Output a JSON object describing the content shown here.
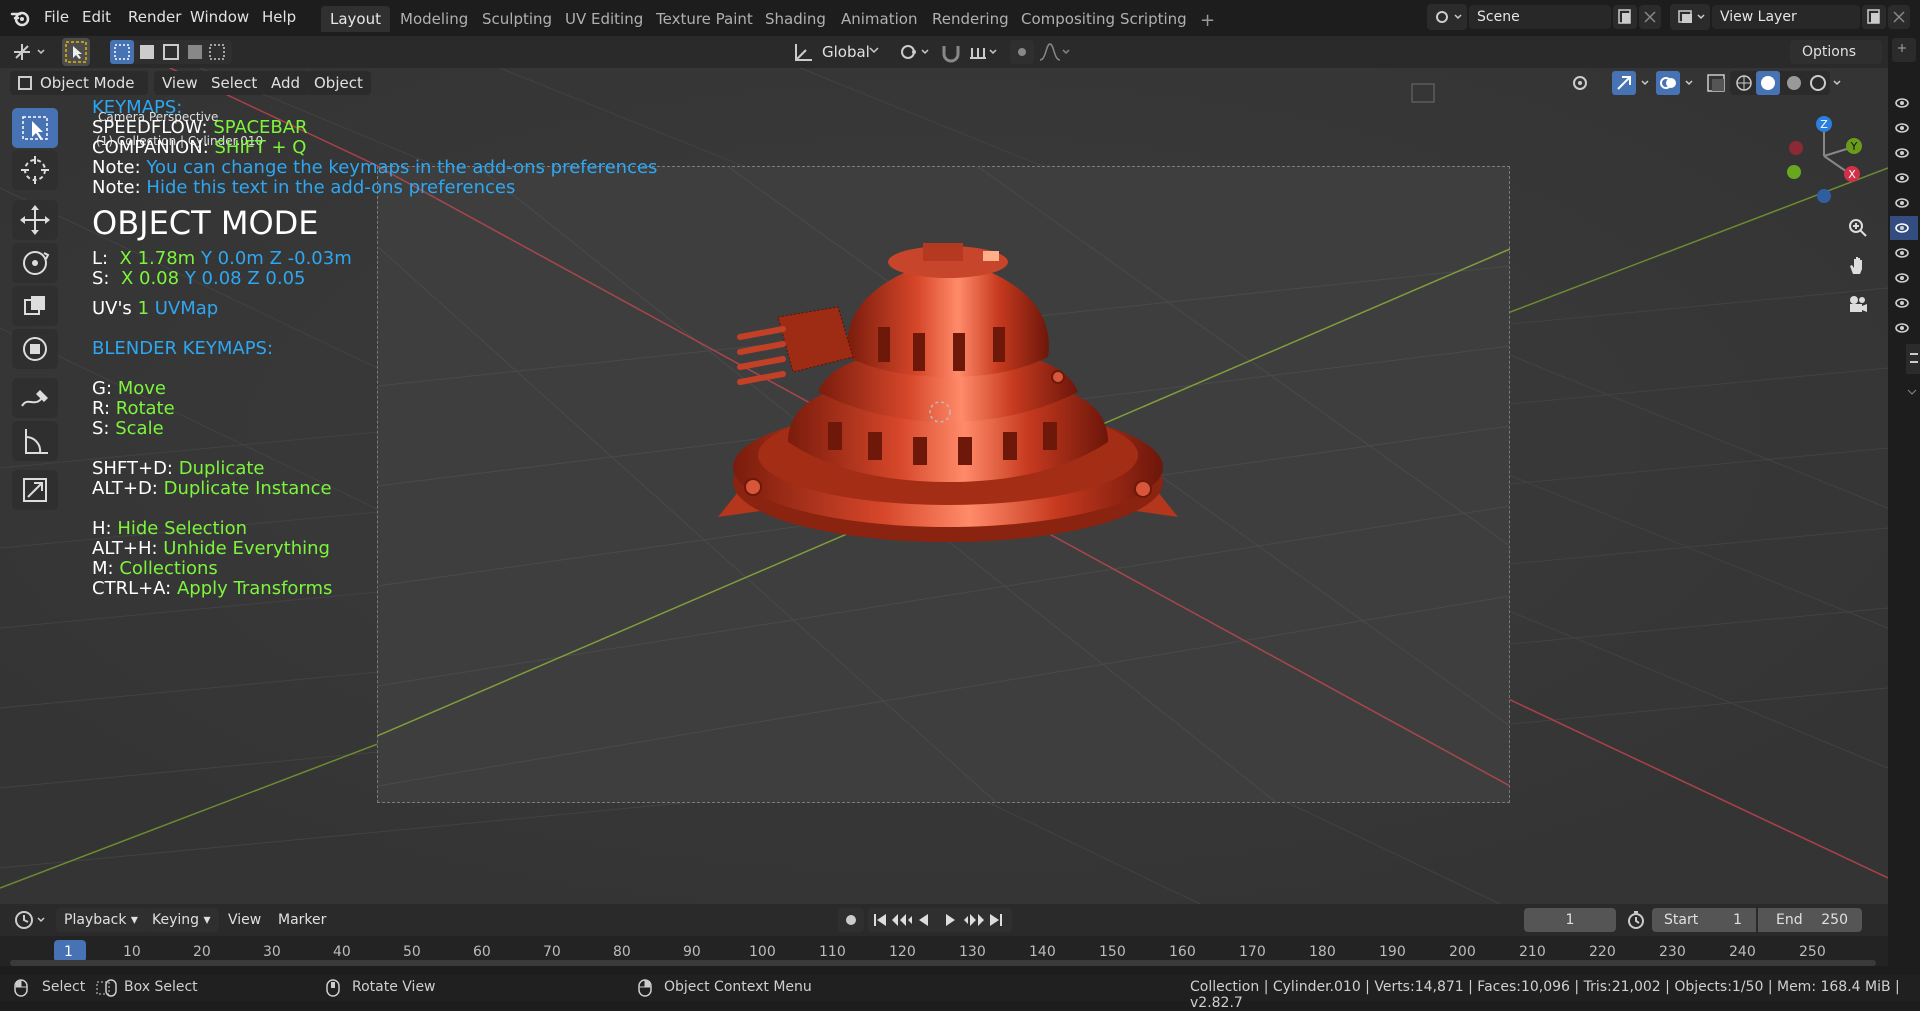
{
  "menu": [
    "File",
    "Edit",
    "Render",
    "Window",
    "Help"
  ],
  "workspaces": [
    "Layout",
    "Modeling",
    "Sculpting",
    "UV Editing",
    "Texture Paint",
    "Shading",
    "Animation",
    "Rendering",
    "Compositing",
    "Scripting"
  ],
  "active_workspace": "Layout",
  "scene": "Scene",
  "view_layer": "View Layer",
  "tool_header": {
    "orientation": "Global",
    "options": "Options"
  },
  "viewport_header": {
    "mode": "Object Mode",
    "view": "View",
    "select": "Select",
    "add": "Add",
    "object": "Object"
  },
  "overlay": {
    "keymaps_title": "KEYMAPS:",
    "camera_label": "Camera Perspective",
    "collection_label": "(1) Collection | Cylinder.010",
    "speedflow_key": "SPEEDFLOW: ",
    "speedflow_val": "SPACEBAR",
    "companion_key": "COMPANION: ",
    "companion_val": "SHIFT + Q",
    "note1_key": "Note: ",
    "note1_val": "You can change the keymaps in the add-ons preferences",
    "note2_key": "Note: ",
    "note2_val": "Hide this text in the add-ons preferences",
    "mode_title": "OBJECT MODE",
    "loc_key": "L:",
    "loc_x": "X 1.78m",
    "loc_y": "Y 0.0m",
    "loc_z": "Z -0.03m",
    "scale_key": "S:",
    "scale_x": "X 0.08",
    "scale_y": "Y 0.08",
    "scale_z": "Z 0.05",
    "uvs_key": "UV's",
    "uvs_count": "1",
    "uvs_name": "UVMap",
    "blender_keymaps": "BLENDER KEYMAPS:",
    "keys": [
      {
        "k": "G: ",
        "v": "Move"
      },
      {
        "k": "R: ",
        "v": "Rotate"
      },
      {
        "k": "S: ",
        "v": "Scale"
      },
      {
        "k": "SHFT+D: ",
        "v": "Duplicate"
      },
      {
        "k": "ALT+D: ",
        "v": "Duplicate Instance"
      },
      {
        "k": "H: ",
        "v": "Hide Selection"
      },
      {
        "k": "ALT+H: ",
        "v": "Unhide Everything"
      },
      {
        "k": "M: ",
        "v": "Collections"
      },
      {
        "k": "CTRL+A: ",
        "v": "Apply Transforms"
      }
    ]
  },
  "gizmo": {
    "x": "X",
    "y": "Y",
    "z": "Z"
  },
  "timeline": {
    "playback": "Playback",
    "keying": "Keying",
    "view": "View",
    "marker": "Marker",
    "current_frame": "1",
    "start_label": "Start",
    "start": "1",
    "end_label": "End",
    "end": "250",
    "ticks": [
      "1",
      "10",
      "20",
      "30",
      "40",
      "50",
      "60",
      "70",
      "80",
      "90",
      "100",
      "110",
      "120",
      "130",
      "140",
      "150",
      "160",
      "170",
      "180",
      "190",
      "200",
      "210",
      "220",
      "230",
      "240",
      "250"
    ]
  },
  "status": {
    "select": "Select",
    "box_select": "Box Select",
    "rotate_view": "Rotate View",
    "context_menu": "Object Context Menu",
    "info": "Collection | Cylinder.010 | Verts:14,871 | Faces:10,096 | Tris:21,002 | Objects:1/50 | Mem: 168.4 MiB | v2.82.7"
  },
  "colors": {
    "accent": "#4772b3",
    "overlay_green": "#7cf53c",
    "overlay_blue": "#2ea7f1",
    "object_red": "#c2331b"
  }
}
